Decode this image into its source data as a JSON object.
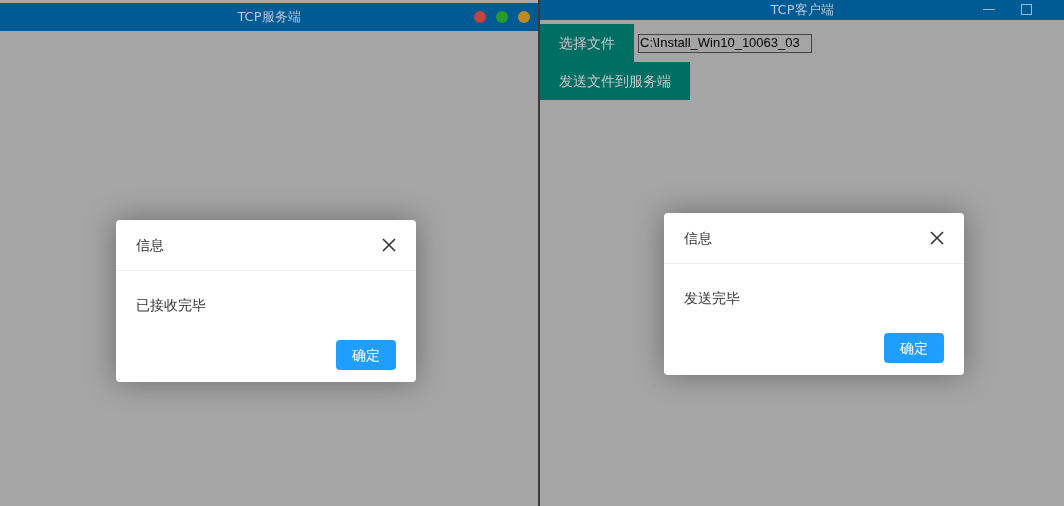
{
  "server_window": {
    "title": "TCP服务端",
    "dialog": {
      "title": "信息",
      "message": "已接收完毕",
      "button": "确定"
    }
  },
  "client_window": {
    "title": "TCP客户端",
    "choose_button": "选择文件",
    "file_path": "C:\\Install_Win10_10063_03",
    "send_button": "发送文件到服务端",
    "dialog": {
      "title": "信息",
      "message": "发送完毕",
      "button": "确定"
    }
  }
}
